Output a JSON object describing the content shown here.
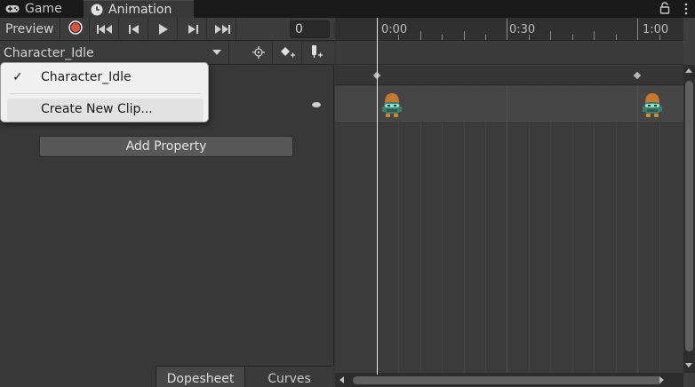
{
  "tabs": {
    "game_label": "Game",
    "animation_label": "Animation",
    "game_icon": "gamepad-icon",
    "animation_icon": "clock-icon",
    "lock_icon": "lock-icon",
    "menu_icon": "kebab-menu-icon"
  },
  "toolbar": {
    "preview_label": "Preview",
    "record_icon": "record-icon",
    "first_key_icon": "first-keyframe-icon",
    "prev_key_icon": "previous-keyframe-icon",
    "play_icon": "play-icon",
    "next_key_icon": "next-keyframe-icon",
    "last_key_icon": "last-keyframe-icon",
    "frame_value": "0",
    "record_color": "#e2503c"
  },
  "clip_bar": {
    "selected_clip": "Character_Idle",
    "filter_icon": "target-icon",
    "add_keyframe_icon": "add-keyframe-icon",
    "add_event_icon": "add-event-icon"
  },
  "dropdown": {
    "items": [
      {
        "label": "Character_Idle",
        "checked": true
      },
      {
        "label": "Create New Clip...",
        "checked": false
      }
    ]
  },
  "property": {
    "add_property_label": "Add Property"
  },
  "bottom_tabs": {
    "dopesheet_label": "Dopesheet",
    "curves_label": "Curves"
  },
  "timeline": {
    "ticks": [
      "0:00",
      "0:30",
      "1:00"
    ],
    "sprite_icon": "character-sprite-icon"
  }
}
